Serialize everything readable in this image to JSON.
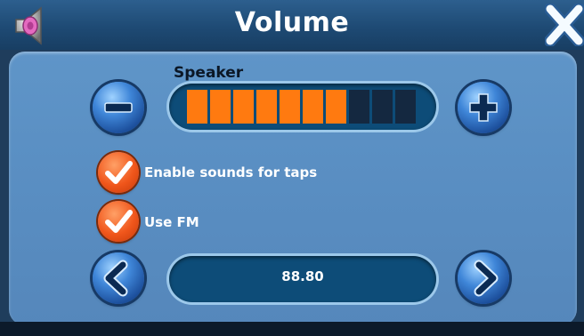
{
  "window": {
    "title": "Volume"
  },
  "icons": {
    "speaker": "speaker-icon",
    "close": "close-icon",
    "decrease": "minus-icon",
    "increase": "plus-icon",
    "previous": "chevron-left-icon",
    "next": "chevron-right-icon",
    "check": "checkmark-icon"
  },
  "volume": {
    "label": "Speaker",
    "segments_total": 10,
    "segments_filled": 7,
    "level_fraction": 0.7
  },
  "options": [
    {
      "label": "Enable sounds for taps",
      "checked": true
    },
    {
      "label": "Use FM",
      "checked": true
    }
  ],
  "fm": {
    "frequency": "88.80"
  },
  "colors": {
    "accent": "#ff7a10",
    "segment_empty": "#142840",
    "panel": "#5a8fc3",
    "titlebar": "#1e4a74"
  }
}
